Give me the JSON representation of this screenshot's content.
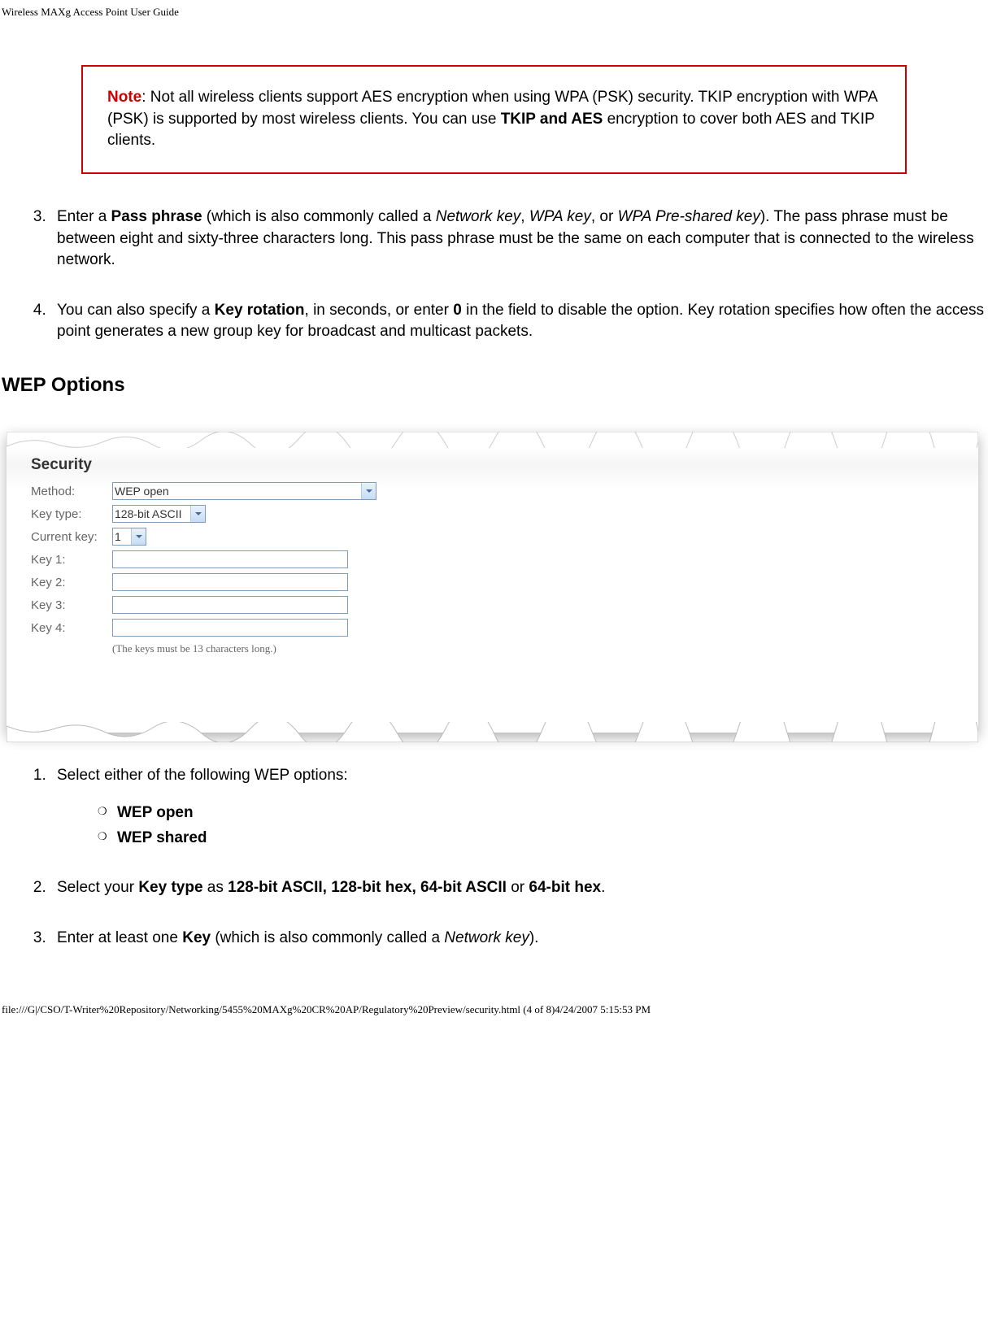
{
  "headerTitle": "Wireless MAXg Access Point User Guide",
  "note": {
    "label": "Note",
    "textPre": ": Not all wireless clients support AES encryption when using WPA (PSK) security. TKIP encryption with WPA (PSK) is supported by most wireless clients. You can use ",
    "boldMid": "TKIP and AES",
    "textPost": " encryption to cover both AES and TKIP clients."
  },
  "step3": {
    "pre": "Enter a ",
    "b1": "Pass phrase",
    "mid1": " (which is also commonly called a ",
    "i1": "Network key",
    "mid2": ", ",
    "i2": "WPA key",
    "mid3": ", or ",
    "i3": "WPA Pre-shared key",
    "post": "). The pass phrase must be between eight and sixty-three characters long. This pass phrase must be the same on each computer that is connected to the wireless network."
  },
  "step4": {
    "pre": "You can also specify a ",
    "b1": "Key rotation",
    "mid1": ", in seconds, or enter ",
    "b2": "0",
    "post": " in the field to disable the option. Key rotation specifies how often the access point generates a new group key for broadcast and multicast packets."
  },
  "wepHeading": "WEP Options",
  "panel": {
    "title": "Security",
    "methodLabel": "Method:",
    "methodValue": "WEP open",
    "keyTypeLabel": "Key type:",
    "keyTypeValue": "128-bit ASCII",
    "currentKeyLabel": "Current key:",
    "currentKeyValue": "1",
    "key1Label": "Key 1:",
    "key2Label": "Key 2:",
    "key3Label": "Key 3:",
    "key4Label": "Key 4:",
    "hint": "(The keys must be 13 characters long.)"
  },
  "wepStep1": {
    "text": "Select either of the following WEP options:",
    "opt1": "WEP open",
    "opt2": "WEP shared"
  },
  "wepStep2": {
    "pre": "Select your ",
    "b1": "Key type",
    "mid1": " as ",
    "b2": "128-bit ASCII, 128-bit hex, 64-bit ASCII",
    "mid2": " or ",
    "b3": "64-bit hex",
    "post": "."
  },
  "wepStep3": {
    "pre": "Enter at least one ",
    "b1": "Key",
    "mid1": " (which is also commonly called a ",
    "i1": "Network key",
    "post": ")."
  },
  "footer": "file:///G|/CSO/T-Writer%20Repository/Networking/5455%20MAXg%20CR%20AP/Regulatory%20Preview/security.html (4 of 8)4/24/2007 5:15:53 PM"
}
